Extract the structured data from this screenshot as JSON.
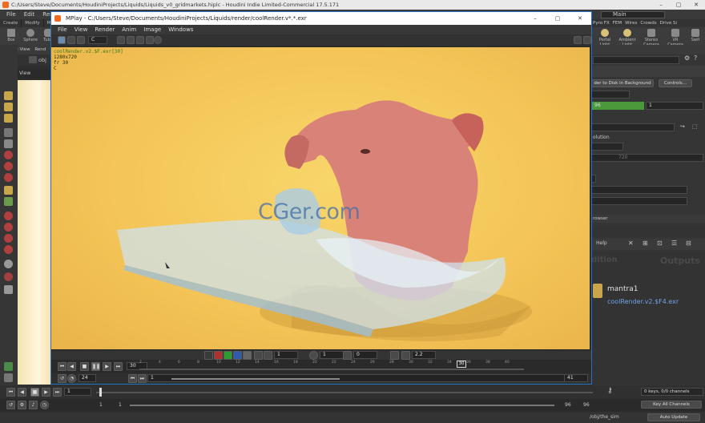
{
  "houdini": {
    "window_title": "C:/Users/Steve/Documents/HoudiniProjects/Liquids/Liquids_v0_gridmarkets.hiplc - Houdini Indie Limited-Commercial 17.5.171",
    "menus": [
      "File",
      "Edit",
      "Render"
    ],
    "desktop": "Main",
    "shelf_tabs": [
      "Create",
      "Modify",
      "Mode"
    ],
    "shelf_tabs_right": [
      "Pyro FX",
      "FEM",
      "Wires",
      "Crowds",
      "Drive Si"
    ],
    "shelf_tools": [
      "Box",
      "Sphere",
      "Tube"
    ],
    "shelf_tools_right": [
      "Portal Light",
      "Ambient Light",
      "Stereo Camera",
      "VR Camera",
      "Swit"
    ],
    "scene_tabs": [
      "Scene View",
      "Rend"
    ],
    "path": "obj",
    "view_label": "View",
    "right": {
      "render_to_disk": "der to Disk in Background",
      "controls": "Controls...",
      "frame_start": "96",
      "frame_end": "1",
      "resolution_label": "olution",
      "res_value": "720",
      "browser_tab": "rowser",
      "help": "Help",
      "edition": "dition",
      "outputs": "Outputs",
      "node_name": "mantra1",
      "node_output": "coolRender.v2.$F4.exr"
    },
    "timeline": {
      "frame": "1",
      "range_start": "1",
      "range_start2": "1",
      "range_end": "96",
      "range_end2": "96",
      "keys_info": "0 keys, 0/0 channels",
      "key_all": "Key All Channels",
      "obj_path": "/obj/the_sim",
      "auto_update": "Auto Update"
    }
  },
  "mplay": {
    "title": "MPlay - C:/Users/Steve/Documents/HoudiniProjects/Liquids/render/coolRender.v*.*.exr",
    "menus": [
      "File",
      "View",
      "Render",
      "Anim",
      "Image",
      "Windows"
    ],
    "channel": "C",
    "info": {
      "filename": "coolRender.v2.$F.exr[30]",
      "resolution": "1280x720",
      "frame": "fr 30",
      "plane": "C"
    },
    "watermark": "CGer.com",
    "controls": {
      "field1": "1",
      "field2": "1",
      "field3": "0",
      "gamma": "2.2",
      "current_frame": "30",
      "fps": "24",
      "range_start": "1",
      "range_end": "41",
      "marker": "30"
    },
    "ticks": [
      "2",
      "4",
      "6",
      "8",
      "10",
      "12",
      "14",
      "16",
      "18",
      "20",
      "22",
      "24",
      "26",
      "28",
      "30",
      "32",
      "34",
      "36",
      "38",
      "40"
    ]
  },
  "colors": {
    "render_bg": "#f4c558",
    "accent_blue": "#1f74c6",
    "houdini_orange": "#f06b1f",
    "node_output_blue": "#6fa3e8"
  }
}
